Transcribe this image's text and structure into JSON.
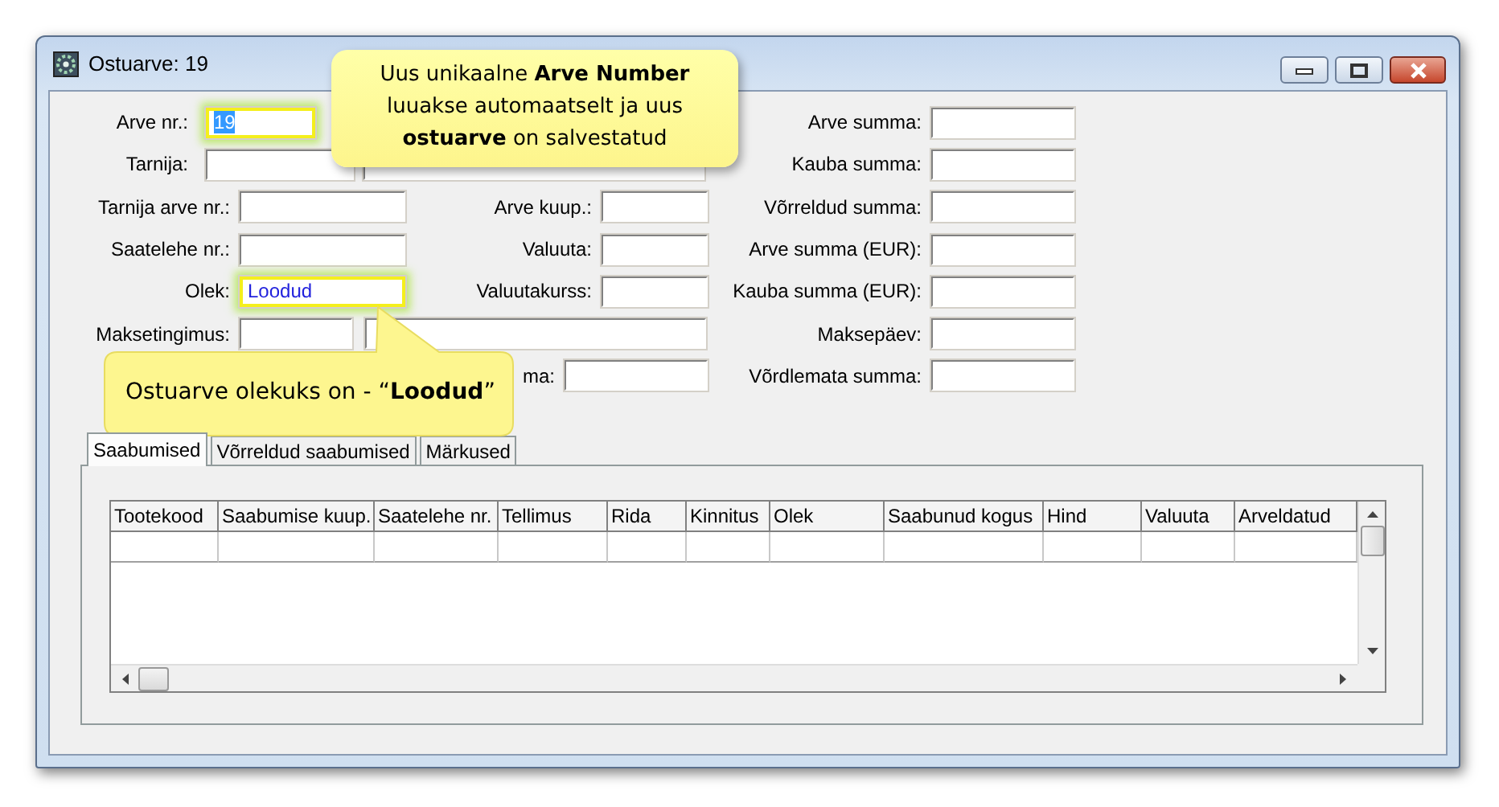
{
  "window": {
    "title": "Ostuarve: 19"
  },
  "form": {
    "rows": [
      {
        "left": {
          "label": "Arve nr.:",
          "value": "19",
          "text_selected": true,
          "highlighted": true
        },
        "right": {
          "label": "Arve summa:"
        }
      },
      {
        "left": {
          "label": "Tarnija:",
          "wide_field": true
        },
        "right": {
          "label": "Kauba summa:"
        }
      },
      {
        "left": {
          "label": "Tarnija arve nr.:"
        },
        "middle": {
          "label": "Arve kuup.:"
        },
        "right": {
          "label": "Võrreldud summa:"
        }
      },
      {
        "left": {
          "label": "Saatelehe nr.:"
        },
        "middle": {
          "label": "Valuuta:"
        },
        "right": {
          "label": "Arve summa (EUR):"
        }
      },
      {
        "left": {
          "label": "Olek:",
          "value": "Loodud",
          "text_selected": false,
          "highlighted": true
        },
        "middle": {
          "label": "Valuutakurss:"
        },
        "right": {
          "label": "Kauba summa (EUR):"
        }
      },
      {
        "left": {
          "label": "Maksetingimus:",
          "wide_field": true
        },
        "right": {
          "label": "Maksepäev:"
        }
      },
      {
        "middle": {
          "label": "ma:"
        },
        "right": {
          "label": "Võrdlemata summa:"
        }
      }
    ]
  },
  "callouts": [
    {
      "text": "Uus unikaalne  **Arve Number** luuakse automaatselt ja uus **ostuarve** on salvestatud"
    },
    {
      "text": "Ostuarve olekuks on - “**Loodud**”"
    }
  ],
  "tabs": [
    {
      "label": "Saabumised",
      "selected": true
    },
    {
      "label": "Võrreldud saabumised",
      "selected": false
    },
    {
      "label": "Märkused",
      "selected": false
    }
  ],
  "table": {
    "columns": [
      "Tootekood",
      "Saabumise kuup.",
      "Saatelehe nr.",
      "Tellimus",
      "Rida",
      "Kinnitus",
      "Olek",
      "Saabunud kogus",
      "Hind",
      "Valuuta",
      "Arveldatud"
    ]
  }
}
